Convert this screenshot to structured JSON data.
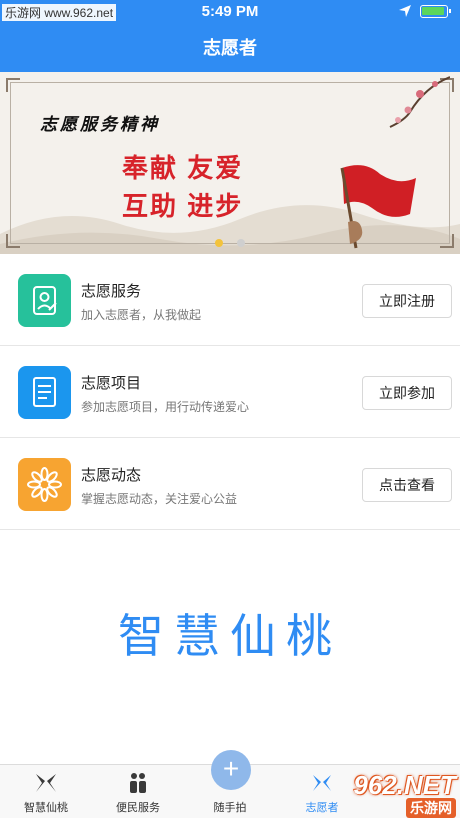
{
  "status": {
    "watermark_top": "乐游网 www.962.net",
    "time": "5:49 PM",
    "icons": [
      "location-arrow-icon",
      "battery-icon"
    ]
  },
  "nav": {
    "title": "志愿者"
  },
  "banner": {
    "spirit": "志愿服务精神",
    "slogan_line1": "奉献  友爱",
    "slogan_line2": "互助  进步",
    "active_page": 1,
    "page_count": 2
  },
  "items": [
    {
      "title": "志愿服务",
      "subtitle": "加入志愿者，从我做起",
      "button": "立即注册",
      "icon": "volunteer-person-icon",
      "color": "#26c19b"
    },
    {
      "title": "志愿项目",
      "subtitle": "参加志愿项目，用行动传递爱心",
      "button": "立即参加",
      "icon": "document-icon",
      "color": "#1b96ee"
    },
    {
      "title": "志愿动态",
      "subtitle": "掌握志愿动态，关注爱心公益",
      "button": "点击查看",
      "icon": "sunflower-icon",
      "color": "#f7a431"
    }
  ],
  "brand": "智慧仙桃",
  "tabs": [
    {
      "label": "智慧仙桃",
      "icon": "butterfly-logo-icon"
    },
    {
      "label": "便民服务",
      "icon": "people-icon"
    },
    {
      "label": "随手拍",
      "icon": "plus-icon"
    },
    {
      "label": "志愿者",
      "icon": "volunteer-icon",
      "active": true
    }
  ],
  "watermark_bottom": {
    "top": "962.NET",
    "bottom": "乐游网"
  }
}
